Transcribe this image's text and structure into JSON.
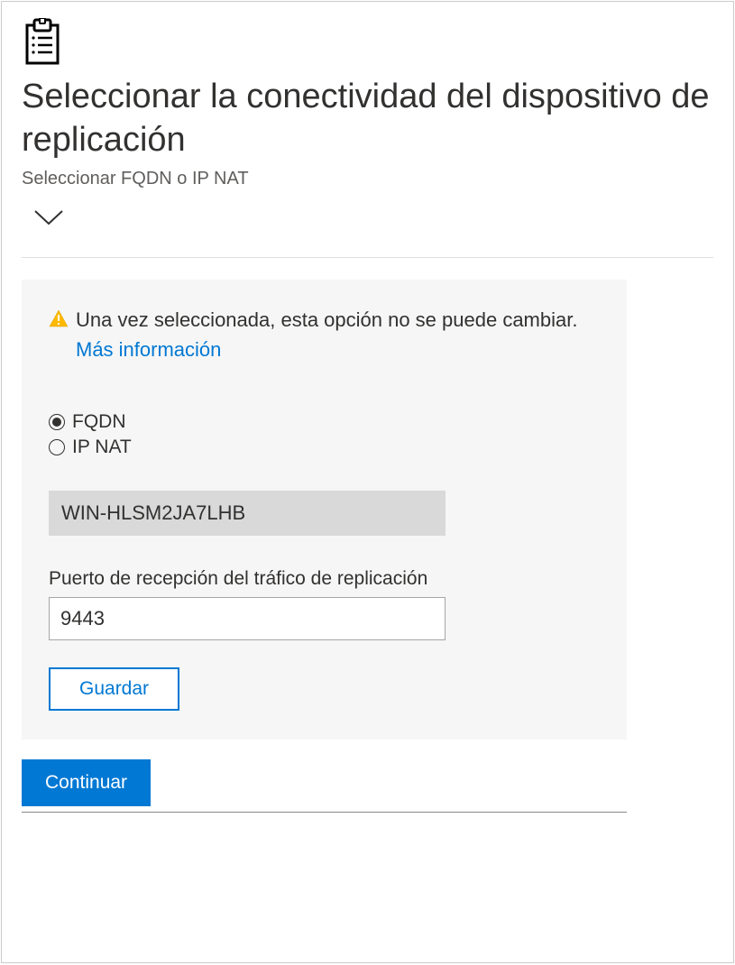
{
  "header": {
    "title": "Seleccionar la conectividad del dispositivo de replicación",
    "subtitle": "Seleccionar FQDN o IP NAT"
  },
  "warning": {
    "text": "Una vez seleccionada, esta opción no se puede cambiar. ",
    "link_text": "Más información"
  },
  "radios": {
    "option1": "FQDN",
    "option2": "IP NAT",
    "selected": "FQDN"
  },
  "hostname": "WIN-HLSM2JA7LHB",
  "port": {
    "label": "Puerto de recepción del tráfico de replicación",
    "value": "9443"
  },
  "buttons": {
    "save": "Guardar",
    "continue": "Continuar"
  }
}
